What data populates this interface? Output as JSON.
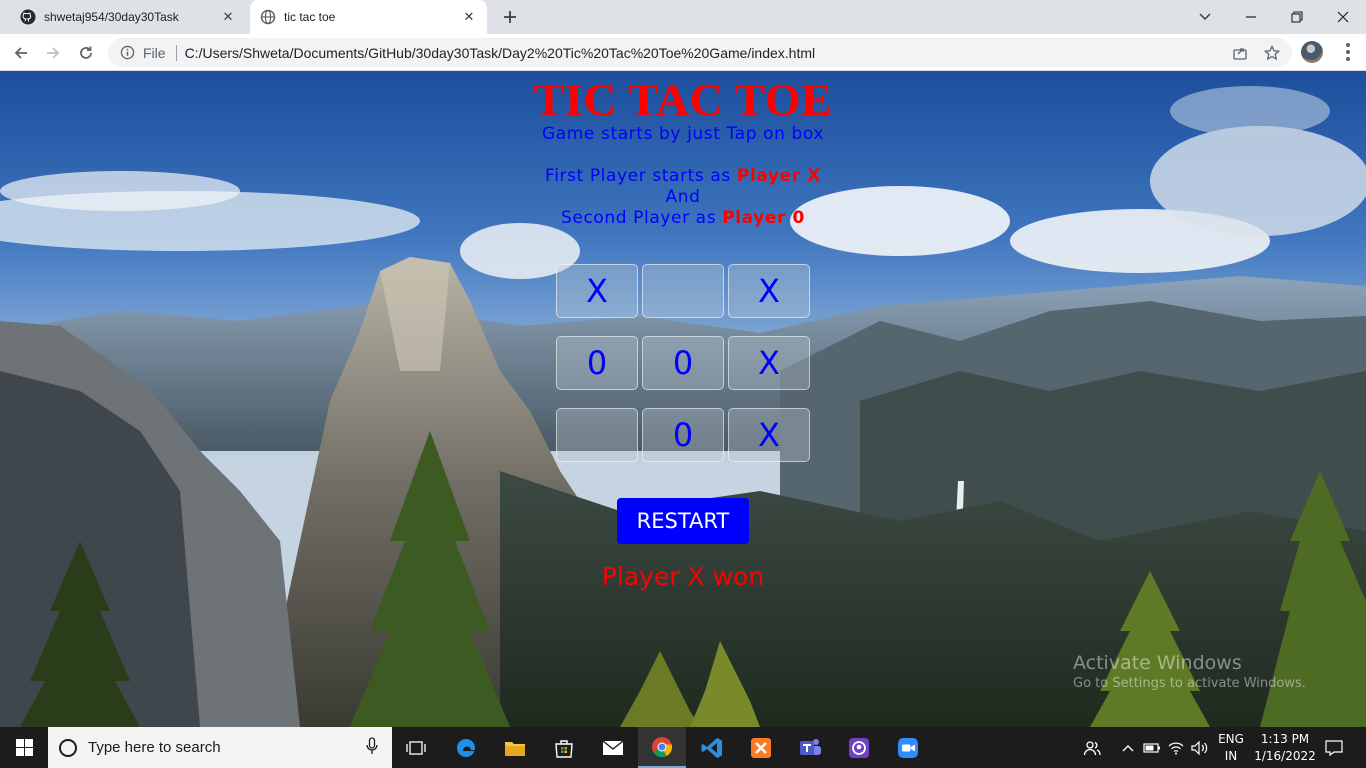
{
  "browser": {
    "tabs": [
      {
        "title": "shwetaj954/30day30Task",
        "icon": "github-icon"
      },
      {
        "title": "tic tac toe",
        "icon": "globe-icon"
      }
    ],
    "file_label": "File",
    "url": "C:/Users/Shweta/Documents/GitHub/30day30Task/Day2%20Tic%20Tac%20Toe%20Game/index.html"
  },
  "page": {
    "title": "TIC TAC TOE",
    "subtitle": "Game starts by just Tap on box",
    "line1_prefix": "First Player starts as",
    "line1_player": "Player X",
    "line2": "And",
    "line3_prefix": "Second Player as",
    "line3_player": "Player 0",
    "board": [
      "X",
      "",
      "X",
      "0",
      "0",
      "X",
      "",
      "0",
      "X"
    ],
    "restart_label": "RESTART",
    "result": "Player X won"
  },
  "watermark": {
    "line1": "Activate Windows",
    "line2": "Go to Settings to activate Windows."
  },
  "taskbar": {
    "search_placeholder": "Type here to search",
    "lang_top": "ENG",
    "lang_bottom": "IN",
    "time": "1:13 PM",
    "date": "1/16/2022"
  },
  "colors": {
    "title": "#ff0000",
    "text": "#0000ff",
    "button": "#0000ff",
    "result": "#ff0000"
  }
}
